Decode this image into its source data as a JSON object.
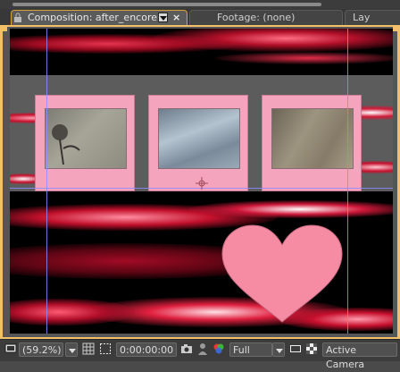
{
  "tabs": {
    "composition_label": "Composition: after_encore",
    "footage_label": "Footage: (none)",
    "layer_label": "Lay"
  },
  "toolbar": {
    "zoom_value": "(59.2%)",
    "timecode": "0:00:00:00",
    "resolution": "Full",
    "camera": "Active Camera"
  },
  "colors": {
    "active_tab_border": "#d8a23a",
    "frame_pink": "#f5a4bd",
    "guide": "#8c8cff",
    "streak_red": "#c8102e"
  },
  "icons": [
    "lock-icon",
    "dropdown-icon",
    "close-icon",
    "monitor-icon",
    "grid-icon",
    "roi-icon",
    "snapshot-icon",
    "show-snapshot-icon",
    "channel-icon",
    "region-icon",
    "transparency-icon"
  ]
}
